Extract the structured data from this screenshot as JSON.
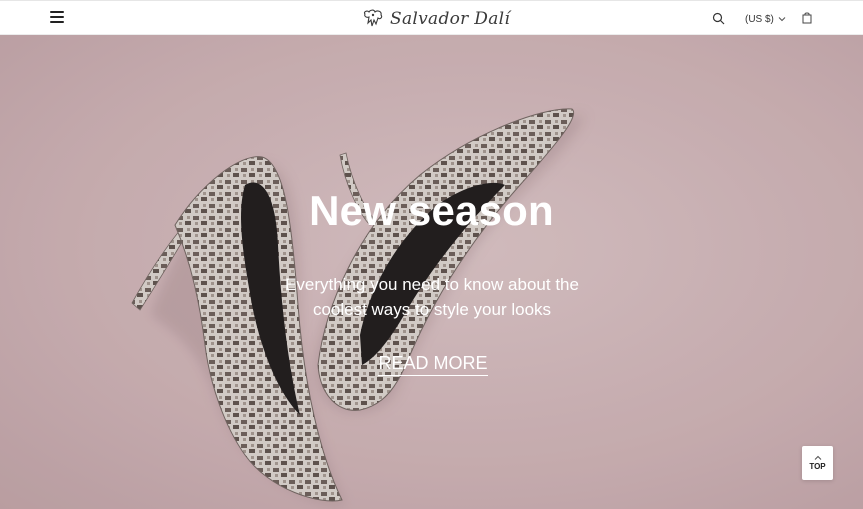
{
  "header": {
    "brand": "Salvador Dalí",
    "currency": "(US $)",
    "icons": {
      "menu": "hamburger-menu-icon",
      "logo": "logo-mark-icon",
      "search": "search-icon",
      "currency_toggle": "chevron-down-icon",
      "cart": "shopping-bag-icon"
    }
  },
  "hero": {
    "title": "New season",
    "subtitle": "Everything you need to know about the coolest ways to style your looks",
    "cta": "READ MORE",
    "background_color": "#cdb3b6"
  },
  "back_to_top": {
    "label": "TOP",
    "icon": "chevron-up-icon"
  },
  "colors": {
    "text_dark": "#222222",
    "hero_text": "#ffffff"
  }
}
